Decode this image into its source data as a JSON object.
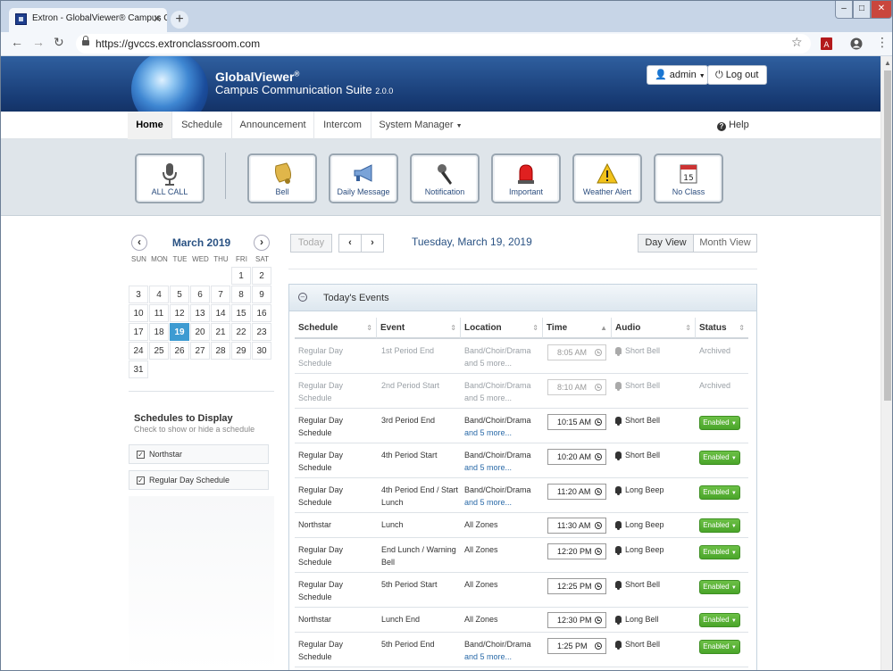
{
  "browser": {
    "tab_title": "Extron - GlobalViewer® Campus Co",
    "url": "https://gvccs.extronclassroom.com",
    "controls": {
      "minimize": "–",
      "maximize": "□",
      "close": "✕"
    }
  },
  "header": {
    "brand_line1": "GlobalViewer",
    "brand_reg": "®",
    "brand_line2": "Campus Communication Suite",
    "version": "2.0.0",
    "user_button": "admin",
    "logout_button": "Log out"
  },
  "menu": {
    "items": [
      "Home",
      "Schedule",
      "Announcement",
      "Intercom",
      "System Manager"
    ],
    "active": "Home",
    "help": "Help"
  },
  "actions": [
    {
      "label": "ALL CALL",
      "icon": "microphone-icon"
    },
    {
      "label": "Bell",
      "icon": "bell-icon"
    },
    {
      "label": "Daily Message",
      "icon": "megaphone-icon"
    },
    {
      "label": "Notification",
      "icon": "handheld-mic-icon"
    },
    {
      "label": "Important",
      "icon": "siren-icon"
    },
    {
      "label": "Weather Alert",
      "icon": "warning-icon"
    },
    {
      "label": "No Class",
      "icon": "calendar-icon"
    }
  ],
  "calendar": {
    "month": "March 2019",
    "dow": [
      "SUN",
      "MON",
      "TUE",
      "WED",
      "THU",
      "FRI",
      "SAT"
    ],
    "weeks": [
      [
        "",
        "",
        "",
        "",
        "",
        "1",
        "2"
      ],
      [
        "3",
        "4",
        "5",
        "6",
        "7",
        "8",
        "9"
      ],
      [
        "10",
        "11",
        "12",
        "13",
        "14",
        "15",
        "16"
      ],
      [
        "17",
        "18",
        "19",
        "20",
        "21",
        "22",
        "23"
      ],
      [
        "24",
        "25",
        "26",
        "27",
        "28",
        "29",
        "30"
      ],
      [
        "31",
        "",
        "",
        "",
        "",
        "",
        ""
      ]
    ],
    "selected": "19"
  },
  "schedules_panel": {
    "title": "Schedules to Display",
    "subtitle": "Check to show or hide a schedule",
    "items": [
      {
        "label": "Northstar",
        "checked": true
      },
      {
        "label": "Regular Day Schedule",
        "checked": true
      }
    ]
  },
  "controls": {
    "today": "Today",
    "date_title": "Tuesday, March 19, 2019",
    "day_view": "Day View",
    "month_view": "Month View"
  },
  "events": {
    "title": "Today's Events",
    "columns": [
      "Schedule",
      "Event",
      "Location",
      "Time",
      "Audio",
      "Status"
    ],
    "rows": [
      {
        "schedule": "Regular Day Schedule",
        "event": "1st Period End",
        "location": "Band/Choir/Drama",
        "more": "and 5 more...",
        "time": "8:05 AM",
        "audio": "Short Bell",
        "status": "Archived"
      },
      {
        "schedule": "Regular Day Schedule",
        "event": "2nd Period Start",
        "location": "Band/Choir/Drama",
        "more": "and 5 more...",
        "time": "8:10 AM",
        "audio": "Short Bell",
        "status": "Archived"
      },
      {
        "schedule": "Regular Day Schedule",
        "event": "3rd Period End",
        "location": "Band/Choir/Drama",
        "more": "and 5 more...",
        "time": "10:15 AM",
        "audio": "Short Bell",
        "status": "Enabled"
      },
      {
        "schedule": "Regular Day Schedule",
        "event": "4th Period Start",
        "location": "Band/Choir/Drama",
        "more": "and 5 more...",
        "time": "10:20 AM",
        "audio": "Short Bell",
        "status": "Enabled"
      },
      {
        "schedule": "Regular Day Schedule",
        "event": "4th Period End / Start Lunch",
        "location": "Band/Choir/Drama",
        "more": "and 5 more...",
        "time": "11:20 AM",
        "audio": "Long Beep",
        "status": "Enabled"
      },
      {
        "schedule": "Northstar",
        "event": "Lunch",
        "location": "All Zones",
        "more": "",
        "time": "11:30 AM",
        "audio": "Long Beep",
        "status": "Enabled"
      },
      {
        "schedule": "Regular Day Schedule",
        "event": "End Lunch / Warning Bell",
        "location": "All Zones",
        "more": "",
        "time": "12:20 PM",
        "audio": "Long Beep",
        "status": "Enabled"
      },
      {
        "schedule": "Regular Day Schedule",
        "event": "5th Period Start",
        "location": "All Zones",
        "more": "",
        "time": "12:25 PM",
        "audio": "Short Bell",
        "status": "Enabled"
      },
      {
        "schedule": "Northstar",
        "event": "Lunch End",
        "location": "All Zones",
        "more": "",
        "time": "12:30 PM",
        "audio": "Long Bell",
        "status": "Enabled"
      },
      {
        "schedule": "Regular Day Schedule",
        "event": "5th Period End",
        "location": "Band/Choir/Drama",
        "more": "and 5 more...",
        "time": "1:25 PM",
        "audio": "Short Bell",
        "status": "Enabled"
      }
    ]
  },
  "colors": {
    "header_blue": "#173a73",
    "accent": "#3d9bd2",
    "enabled_green": "#4aa52a"
  }
}
